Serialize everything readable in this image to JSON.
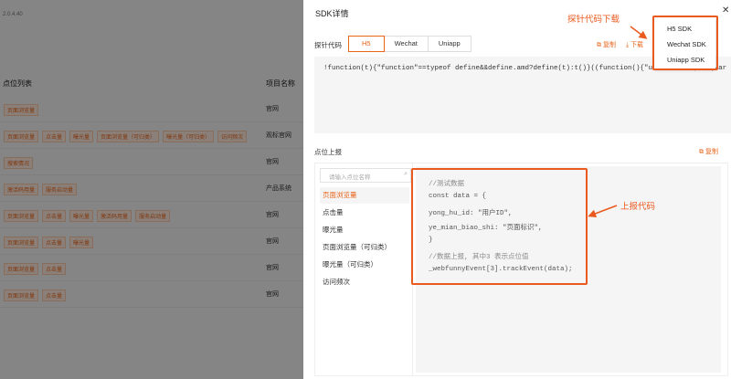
{
  "background": {
    "version": "2.0.4.40",
    "col_points": "点位列表",
    "col_project": "项目名称",
    "rows": [
      {
        "tags": [
          "页面浏览量"
        ],
        "project": "官网"
      },
      {
        "tags": [
          "页面浏览量",
          "点击量",
          "曝光量",
          "页面浏览量（可归类）",
          "曝光量（可归类）",
          "访问频次"
        ],
        "project": "观标官网"
      },
      {
        "tags": [
          "搜索情况"
        ],
        "project": "官网"
      },
      {
        "tags": [
          "激活码用量",
          "服务启动量"
        ],
        "project": "产品系统"
      },
      {
        "tags": [
          "页面浏览量",
          "点击量",
          "曝光量",
          "激活码用量",
          "服务启动量"
        ],
        "project": "官网"
      },
      {
        "tags": [
          "页面浏览量",
          "点击量",
          "曝光量"
        ],
        "project": "官网"
      },
      {
        "tags": [
          "页面浏览量",
          "点击量"
        ],
        "project": "官网"
      },
      {
        "tags": [
          "页面浏览量",
          "点击量"
        ],
        "project": "官网"
      }
    ]
  },
  "drawer": {
    "title": "SDK详情",
    "close": "✕",
    "probe_label": "探针代码",
    "tabs": [
      "H5",
      "Wechat",
      "Uniapp"
    ],
    "copy_label": "复制",
    "download_label": "下载",
    "probe_code": "!function(t){\"function\"==typeof define&&define.amd?define(t):t()}((function(){\"use strict\";for(var e=",
    "report_label": "点位上报",
    "report_copy": "复制",
    "search_placeholder": "请输入点位名称",
    "search_icon": "search-icon",
    "points": [
      "页面浏览量",
      "点击量",
      "曝光量",
      "页面浏览量（可归类）",
      "曝光量（可归类）",
      "访问频次"
    ],
    "code_lines": [
      "//测试数据",
      "const data = {",
      "    yong_hu_id: \"用户ID\",",
      "    ye_mian_biao_shi: \"页面标识\",",
      "}",
      "//数据上报, 其中3 表示点位值",
      "_webfunnyEvent[3].trackEvent(data);"
    ]
  },
  "dropdown": [
    "H5 SDK",
    "Wechat SDK",
    "Uniapp SDK"
  ],
  "annotations": {
    "download_note": "探针代码下载",
    "report_note": "上报代码",
    "color": "#ea5a1f"
  }
}
